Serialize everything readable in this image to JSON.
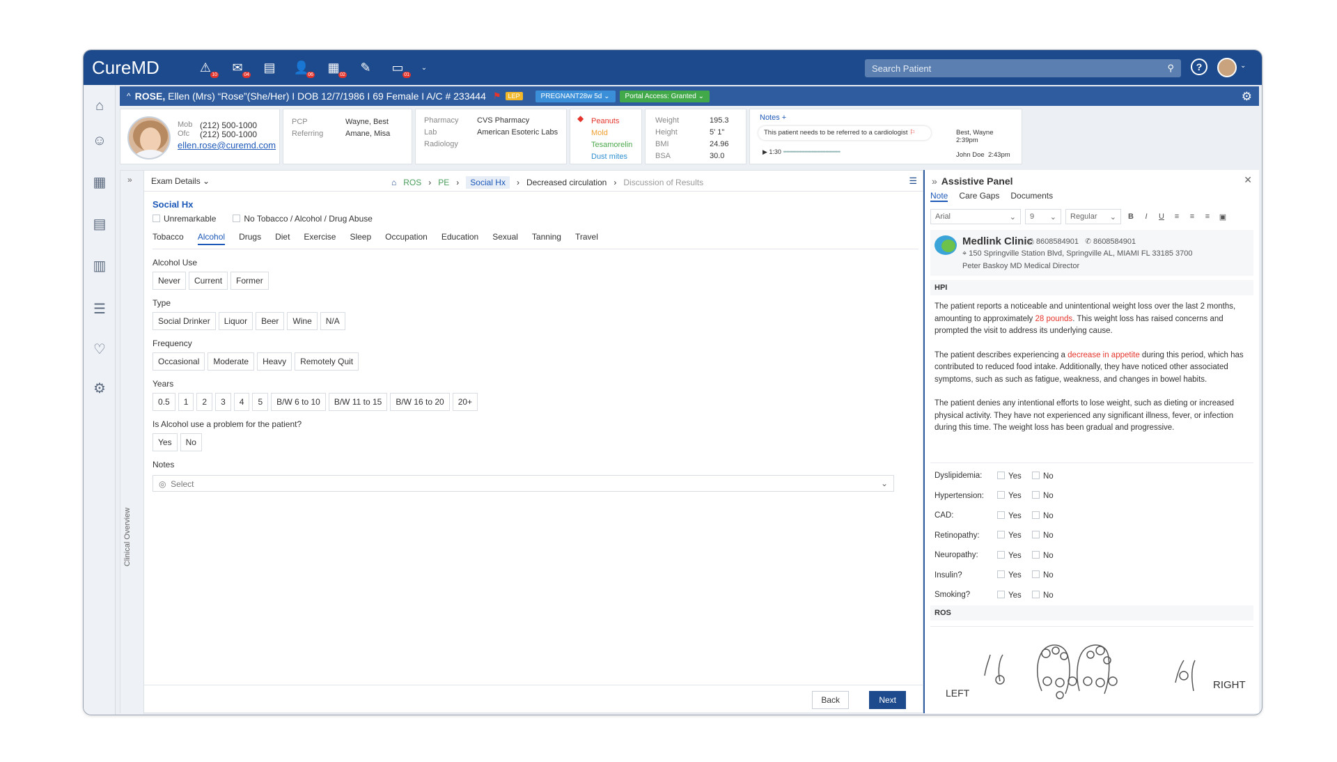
{
  "app": {
    "logo": "CureMD",
    "search_placeholder": "Search Patient"
  },
  "toolbar_badges": [
    "10",
    "04",
    "",
    "06",
    "02",
    "",
    "01"
  ],
  "patient": {
    "caret": "^",
    "name_bold": "ROSE,",
    "name_rest": " Ellen (Mrs) “Rose”(She/Her) I DOB 12/7/1986 I  69 Female I  A/C # 233444",
    "lep": "LEP",
    "pregnant": "PREGNANT28w 5d",
    "portal": "Portal Access: Granted"
  },
  "contact": {
    "mob_label": "Mob",
    "mob": "(212) 500-1000",
    "ofc_label": "Ofc",
    "ofc": "(212) 500-1000",
    "email": "ellen.rose@curemd.com"
  },
  "care": {
    "pcp_label": "PCP",
    "pcp": "Wayne, Best",
    "ref_label": "Referring",
    "ref": "Amane, Misa"
  },
  "services": {
    "pharm_label": "Pharmacy",
    "pharm": "CVS Pharmacy",
    "lab_label": "Lab",
    "lab": "American Esoteric Labs",
    "rad_label": "Radiology"
  },
  "allergies": [
    "Peanuts",
    "Mold",
    "Tesamorelin",
    "Dust mites"
  ],
  "vitals": [
    {
      "k": "Weight",
      "v": "195.3"
    },
    {
      "k": "Height",
      "v": "5' 1\""
    },
    {
      "k": "BMI",
      "v": "24.96"
    },
    {
      "k": "BSA",
      "v": "30.0"
    }
  ],
  "notes": {
    "label": "Notes",
    "note1": "This patient needs to be referred to a cardiologist",
    "author1": "Best, Wayne",
    "time1": "2:39pm",
    "audio_time": "1:30",
    "author2": "John  Doe",
    "time2": "2:43pm"
  },
  "exam": {
    "title": "Exam Details",
    "crumbs": [
      "ROS",
      "PE",
      "Social Hx",
      "Decreased circulation",
      "Discussion of Results"
    ],
    "co_label": "Clinical Overview"
  },
  "socialhx": {
    "title": "Social Hx",
    "unremarkable": "Unremarkable",
    "no_abuse": "No Tobacco / Alcohol / Drug Abuse",
    "tabs": [
      "Tobacco",
      "Alcohol",
      "Drugs",
      "Diet",
      "Exercise",
      "Sleep",
      "Occupation",
      "Education",
      "Sexual",
      "Tanning",
      "Travel"
    ],
    "use_label": "Alcohol Use",
    "use": [
      "Never",
      "Current",
      "Former"
    ],
    "type_label": "Type",
    "type": [
      "Social Drinker",
      "Liquor",
      "Beer",
      "Wine",
      "N/A"
    ],
    "freq_label": "Frequency",
    "freq": [
      "Occasional",
      "Moderate",
      "Heavy",
      "Remotely Quit"
    ],
    "years_label": "Years",
    "years": [
      "0.5",
      "1",
      "2",
      "3",
      "4",
      "5",
      "B/W 6 to 10",
      "B/W 11 to 15",
      "B/W 16 to 20",
      "20+"
    ],
    "problem_label": "Is Alcohol use a problem for the patient?",
    "problem": [
      "Yes",
      "No"
    ],
    "notes_label": "Notes",
    "notes_placeholder": "Select"
  },
  "footer": {
    "back": "Back",
    "next": "Next"
  },
  "assist": {
    "title": "Assistive Panel",
    "tabs": [
      "Note",
      "Care Gaps",
      "Documents"
    ],
    "font": "Arial",
    "size": "9",
    "weight": "Regular",
    "clinic_name": "Medlink Clinic",
    "fax": "8608584901",
    "phone": "8608584901",
    "address": "150 Springville Station Blvd, Springville AL, MIAMI FL 33185 3700",
    "doctor": "Peter Baskoy  MD Medical Director",
    "hpi_label": "HPI",
    "p1a": "The patient reports a noticeable and unintentional weight loss over the last 2 months, amounting to approximately ",
    "p1b": "28 pounds",
    "p1c": ". This weight loss has raised concerns and prompted the visit to address its underlying cause.",
    "p2a": "The patient describes experiencing a ",
    "p2b": "decrease in appetite",
    "p2c": " during this period, which has contributed to reduced food intake. Additionally, they have noticed other associated symptoms, such as such as fatigue, weakness, and changes in bowel habits.",
    "p3": "The patient denies any intentional efforts to lose weight, such as dieting or increased physical activity. They have not experienced any significant illness, fever, or infection during this time. The weight loss has been gradual and progressive.",
    "questions": [
      "Dyslipidemia:",
      "Hypertension:",
      "CAD:",
      "Retinopathy:",
      "Neuropathy:",
      "Insulin?",
      "Smoking?"
    ],
    "yes": "Yes",
    "no": "No",
    "ros_label": "ROS",
    "left": "LEFT",
    "right": "RIGHT"
  }
}
